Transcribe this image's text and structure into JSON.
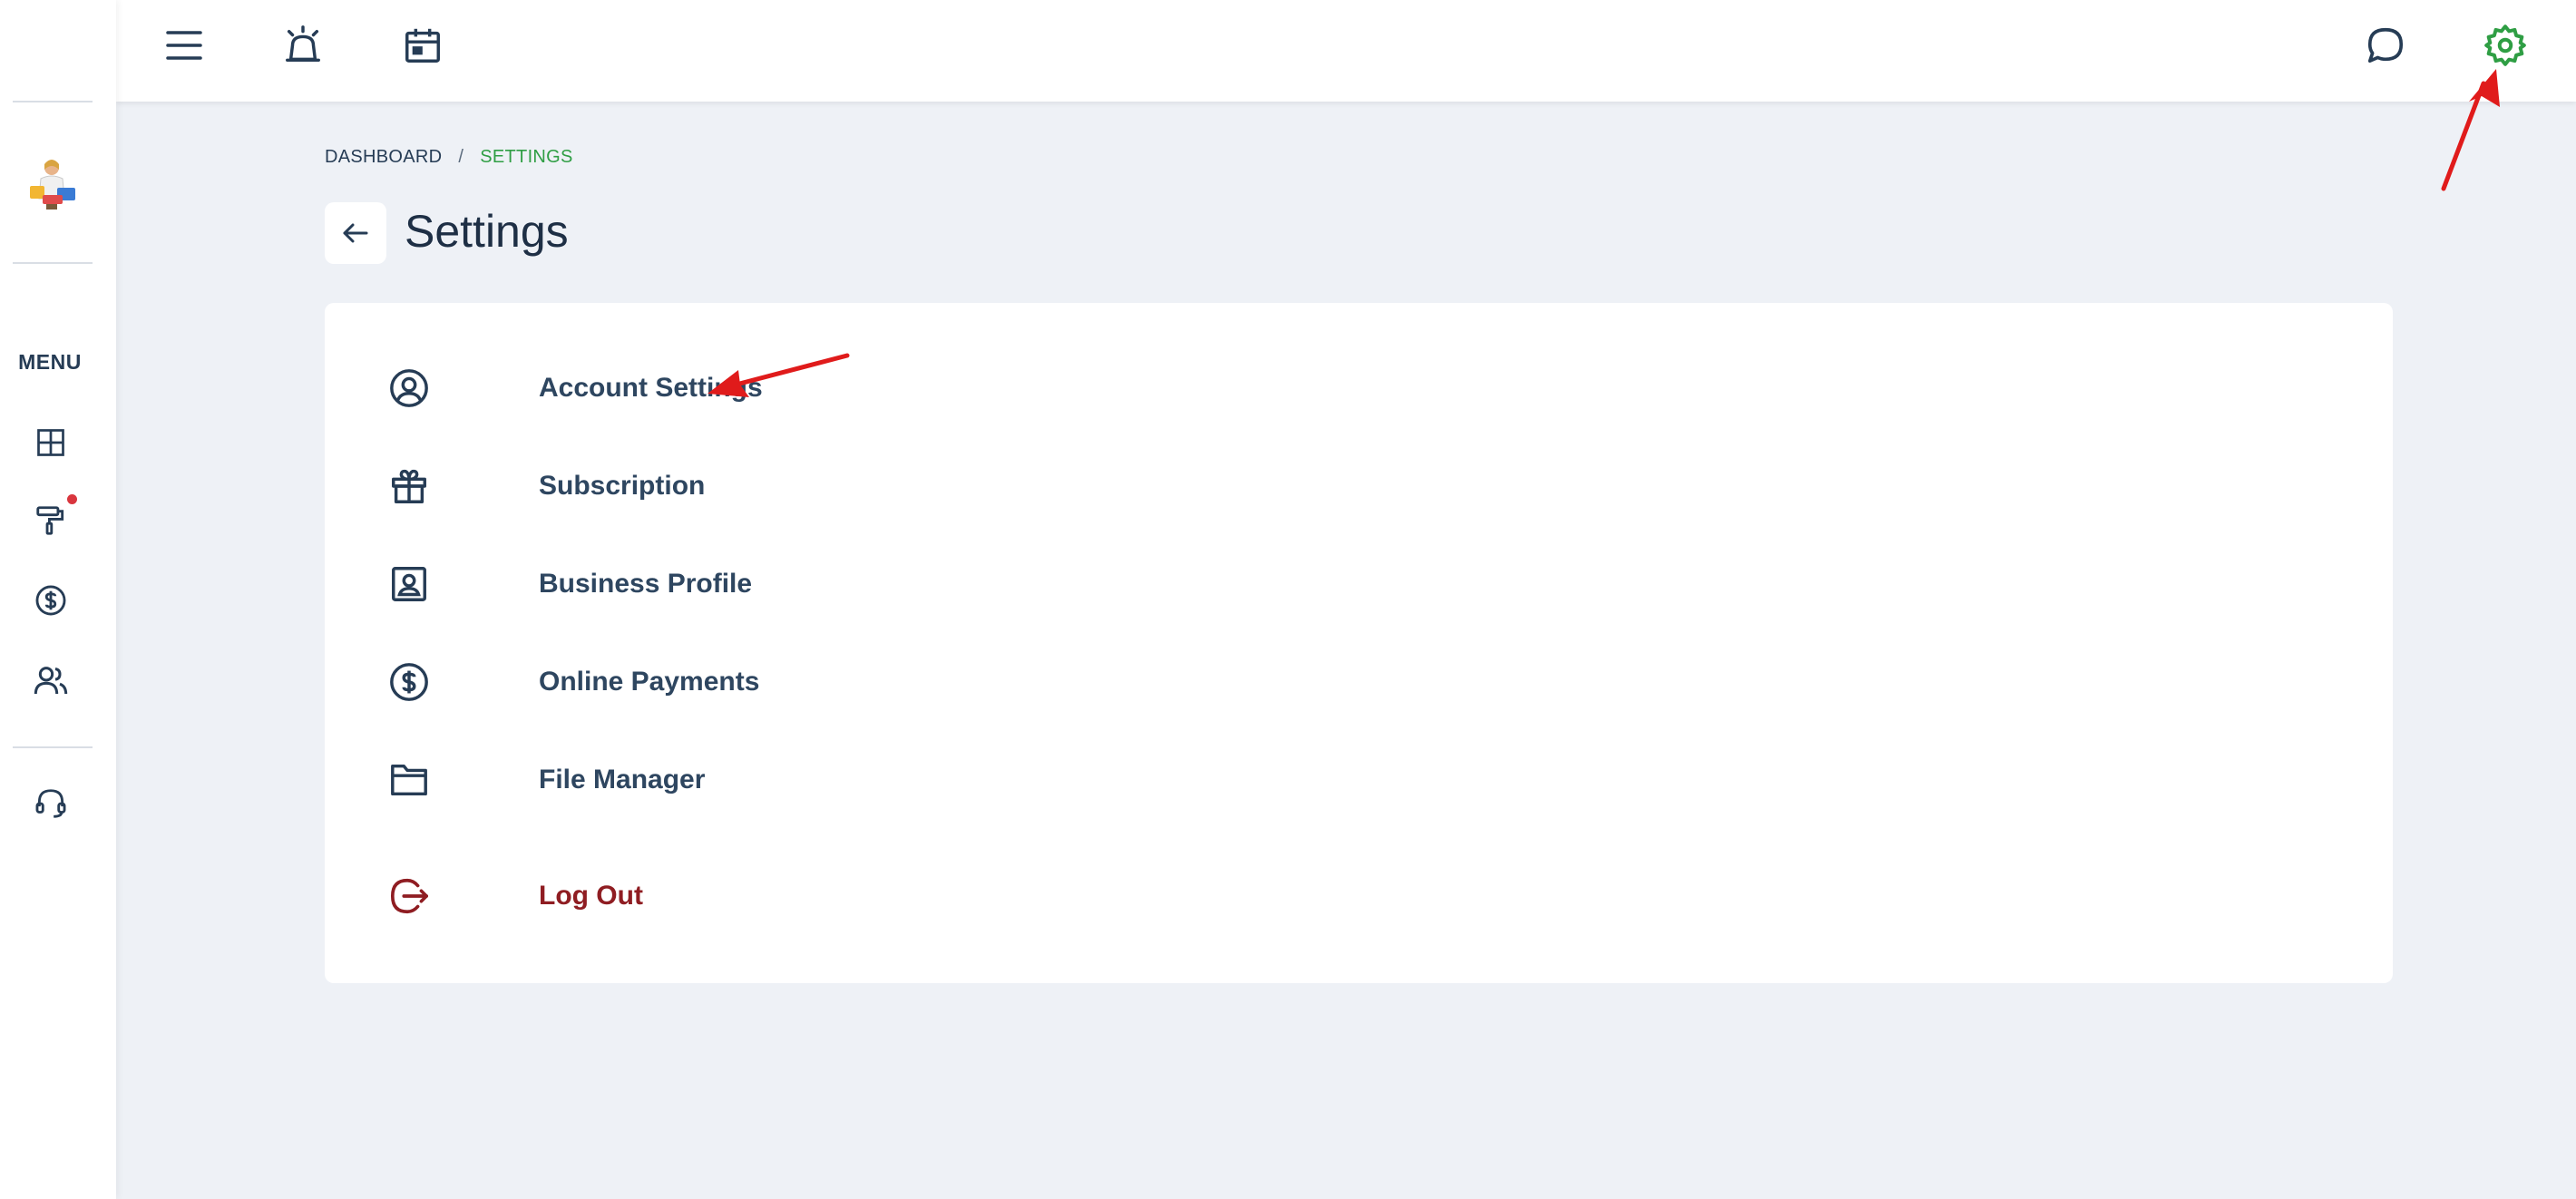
{
  "sidebar": {
    "menu_label": "MENU",
    "items": [
      {
        "icon": "layout-grid-icon"
      },
      {
        "icon": "paint-roller-icon",
        "has_notification": true
      },
      {
        "icon": "dollar-circle-icon"
      },
      {
        "icon": "users-icon"
      },
      {
        "icon": "headset-icon"
      }
    ]
  },
  "topbar": {
    "left_icons": [
      "hamburger-menu-icon",
      "alarm-icon",
      "calendar-icon"
    ],
    "right_icons": [
      "chat-icon",
      "settings-gear-icon"
    ]
  },
  "breadcrumb": {
    "parent": "DASHBOARD",
    "separator": "/",
    "current": "SETTINGS"
  },
  "page": {
    "title": "Settings"
  },
  "settings_menu": [
    {
      "label": "Account Settings",
      "icon": "user-circle-icon"
    },
    {
      "label": "Subscription",
      "icon": "gift-icon"
    },
    {
      "label": "Business Profile",
      "icon": "profile-card-icon"
    },
    {
      "label": "Online Payments",
      "icon": "dollar-circle-icon"
    },
    {
      "label": "File Manager",
      "icon": "folder-icon"
    },
    {
      "label": "Log Out",
      "icon": "logout-icon"
    }
  ],
  "colors": {
    "accent_green": "#2f9e44",
    "logout_red": "#8f1d22",
    "annotation_red": "#e01b1b",
    "text_dark": "#263c55",
    "background": "#eef1f6"
  }
}
